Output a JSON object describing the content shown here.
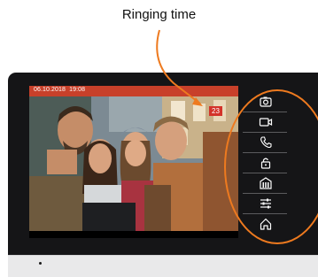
{
  "callout": {
    "label": "Ringing time"
  },
  "screen": {
    "status_date": "06.10.2018",
    "status_time": "19:08",
    "ringing_counter": "23"
  },
  "menu": {
    "items": [
      {
        "icon": "camera-icon"
      },
      {
        "icon": "video-camera-icon"
      },
      {
        "icon": "phone-icon"
      },
      {
        "icon": "lock-icon"
      },
      {
        "icon": "building-icon"
      },
      {
        "icon": "settings-sliders-icon"
      },
      {
        "icon": "home-icon"
      }
    ]
  },
  "colors": {
    "accent": "#ee7a1f",
    "status_bar": "#c8402a",
    "counter_bg": "#d3332a",
    "device_body": "#151517"
  }
}
